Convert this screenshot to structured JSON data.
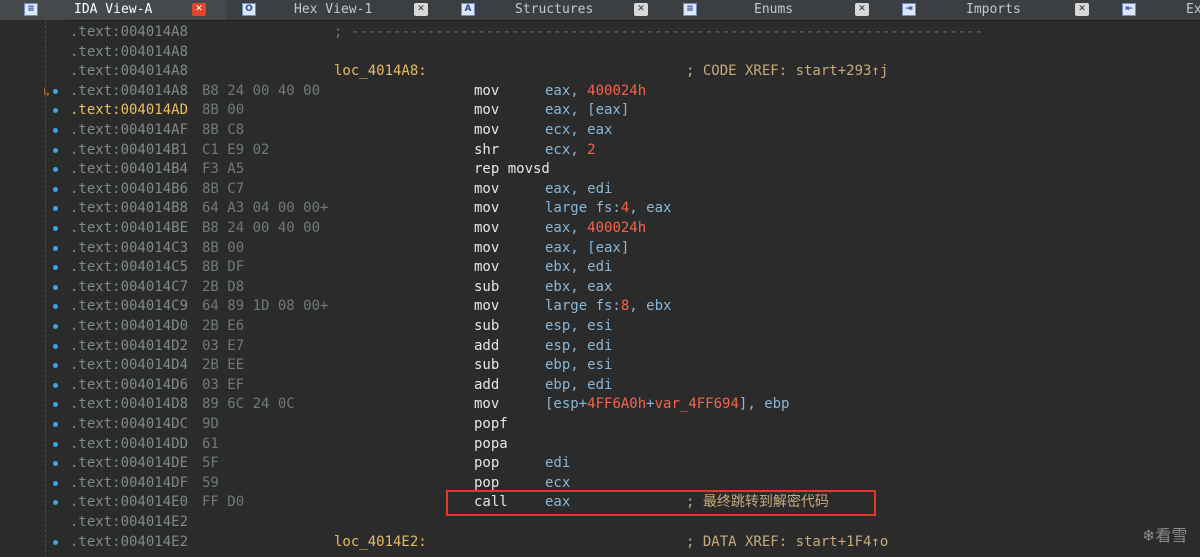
{
  "tabs": [
    {
      "icon": "ida-view-icon",
      "icon_glyph": "≡",
      "label": "IDA View-A",
      "active": true
    },
    {
      "icon": "hex-view-icon",
      "icon_glyph": "O",
      "label": "Hex View-1",
      "active": false
    },
    {
      "icon": "structures-icon",
      "icon_glyph": "A",
      "label": "Structures",
      "active": false
    },
    {
      "icon": "enums-icon",
      "icon_glyph": "≡",
      "label": "Enums",
      "active": false
    },
    {
      "icon": "imports-icon",
      "icon_glyph": "⇥",
      "label": "Imports",
      "active": false
    },
    {
      "icon": "exports-icon",
      "icon_glyph": "⇤",
      "label": "Ex",
      "active": false
    }
  ],
  "separator_text": "; ---------------------------------------------------------------------------",
  "rows": [
    {
      "addr": ".text:004014A8",
      "bytes": "",
      "label": "",
      "mnem": "",
      "ops": [],
      "cmt": "",
      "sep": true,
      "dot": false
    },
    {
      "addr": ".text:004014A8",
      "bytes": "",
      "label": "",
      "mnem": "",
      "ops": [],
      "cmt": "",
      "sep": false,
      "dot": false
    },
    {
      "addr": ".text:004014A8",
      "bytes": "",
      "label": "loc_4014A8:",
      "mnem": "",
      "ops": [],
      "cmt": "; CODE XREF: start+293↑j",
      "sep": false,
      "dot": false
    },
    {
      "addr": ".text:004014A8",
      "bytes": "B8 24 00 40 00",
      "label": "",
      "mnem": "mov",
      "ops": [
        {
          "t": "eax, "
        },
        {
          "t": "400024h",
          "num": true
        }
      ],
      "cmt": "",
      "sep": false,
      "dot": true,
      "arrow": true
    },
    {
      "addr": ".text:004014AD",
      "bytes": "8B 00",
      "label": "",
      "mnem": "mov",
      "ops": [
        {
          "t": "eax, [eax]"
        }
      ],
      "cmt": "",
      "sep": false,
      "dot": true,
      "hl": true
    },
    {
      "addr": ".text:004014AF",
      "bytes": "8B C8",
      "label": "",
      "mnem": "mov",
      "ops": [
        {
          "t": "ecx, eax"
        }
      ],
      "cmt": "",
      "sep": false,
      "dot": true
    },
    {
      "addr": ".text:004014B1",
      "bytes": "C1 E9 02",
      "label": "",
      "mnem": "shr",
      "ops": [
        {
          "t": "ecx, "
        },
        {
          "t": "2",
          "num": true
        }
      ],
      "cmt": "",
      "sep": false,
      "dot": true
    },
    {
      "addr": ".text:004014B4",
      "bytes": "F3 A5",
      "label": "",
      "mnem": "rep movsd",
      "ops": [],
      "cmt": "",
      "sep": false,
      "dot": true
    },
    {
      "addr": ".text:004014B6",
      "bytes": "8B C7",
      "label": "",
      "mnem": "mov",
      "ops": [
        {
          "t": "eax, edi"
        }
      ],
      "cmt": "",
      "sep": false,
      "dot": true
    },
    {
      "addr": ".text:004014B8",
      "bytes": "64 A3 04 00 00+",
      "label": "",
      "mnem": "mov",
      "ops": [
        {
          "t": "large fs:"
        },
        {
          "t": "4",
          "num": true
        },
        {
          "t": ", eax"
        }
      ],
      "cmt": "",
      "sep": false,
      "dot": true
    },
    {
      "addr": ".text:004014BE",
      "bytes": "B8 24 00 40 00",
      "label": "",
      "mnem": "mov",
      "ops": [
        {
          "t": "eax, "
        },
        {
          "t": "400024h",
          "num": true
        }
      ],
      "cmt": "",
      "sep": false,
      "dot": true
    },
    {
      "addr": ".text:004014C3",
      "bytes": "8B 00",
      "label": "",
      "mnem": "mov",
      "ops": [
        {
          "t": "eax, [eax]"
        }
      ],
      "cmt": "",
      "sep": false,
      "dot": true
    },
    {
      "addr": ".text:004014C5",
      "bytes": "8B DF",
      "label": "",
      "mnem": "mov",
      "ops": [
        {
          "t": "ebx, edi"
        }
      ],
      "cmt": "",
      "sep": false,
      "dot": true
    },
    {
      "addr": ".text:004014C7",
      "bytes": "2B D8",
      "label": "",
      "mnem": "sub",
      "ops": [
        {
          "t": "ebx, eax"
        }
      ],
      "cmt": "",
      "sep": false,
      "dot": true
    },
    {
      "addr": ".text:004014C9",
      "bytes": "64 89 1D 08 00+",
      "label": "",
      "mnem": "mov",
      "ops": [
        {
          "t": "large fs:"
        },
        {
          "t": "8",
          "num": true
        },
        {
          "t": ", ebx"
        }
      ],
      "cmt": "",
      "sep": false,
      "dot": true
    },
    {
      "addr": ".text:004014D0",
      "bytes": "2B E6",
      "label": "",
      "mnem": "sub",
      "ops": [
        {
          "t": "esp, esi"
        }
      ],
      "cmt": "",
      "sep": false,
      "dot": true
    },
    {
      "addr": ".text:004014D2",
      "bytes": "03 E7",
      "label": "",
      "mnem": "add",
      "ops": [
        {
          "t": "esp, edi"
        }
      ],
      "cmt": "",
      "sep": false,
      "dot": true
    },
    {
      "addr": ".text:004014D4",
      "bytes": "2B EE",
      "label": "",
      "mnem": "sub",
      "ops": [
        {
          "t": "ebp, esi"
        }
      ],
      "cmt": "",
      "sep": false,
      "dot": true
    },
    {
      "addr": ".text:004014D6",
      "bytes": "03 EF",
      "label": "",
      "mnem": "add",
      "ops": [
        {
          "t": "ebp, edi"
        }
      ],
      "cmt": "",
      "sep": false,
      "dot": true
    },
    {
      "addr": ".text:004014D8",
      "bytes": "89 6C 24 0C",
      "label": "",
      "mnem": "mov",
      "ops": [
        {
          "t": "[esp+"
        },
        {
          "t": "4FF6A0h",
          "num": true
        },
        {
          "t": "+"
        },
        {
          "t": "var_4FF694",
          "num": true
        },
        {
          "t": "], ebp"
        }
      ],
      "cmt": "",
      "sep": false,
      "dot": true
    },
    {
      "addr": ".text:004014DC",
      "bytes": "9D",
      "label": "",
      "mnem": "popf",
      "ops": [],
      "cmt": "",
      "sep": false,
      "dot": true
    },
    {
      "addr": ".text:004014DD",
      "bytes": "61",
      "label": "",
      "mnem": "popa",
      "ops": [],
      "cmt": "",
      "sep": false,
      "dot": true
    },
    {
      "addr": ".text:004014DE",
      "bytes": "5F",
      "label": "",
      "mnem": "pop",
      "ops": [
        {
          "t": "edi"
        }
      ],
      "cmt": "",
      "sep": false,
      "dot": true
    },
    {
      "addr": ".text:004014DF",
      "bytes": "59",
      "label": "",
      "mnem": "pop",
      "ops": [
        {
          "t": "ecx"
        }
      ],
      "cmt": "",
      "sep": false,
      "dot": true
    },
    {
      "addr": ".text:004014E0",
      "bytes": "FF D0",
      "label": "",
      "mnem": "call",
      "ops": [
        {
          "t": "eax"
        }
      ],
      "cmt": "; 最终跳转到解密代码",
      "sep": false,
      "dot": true
    },
    {
      "addr": ".text:004014E2",
      "bytes": "",
      "label": "",
      "mnem": "",
      "ops": [],
      "cmt": "",
      "sep": false,
      "dot": false
    },
    {
      "addr": ".text:004014E2",
      "bytes": "",
      "label": "loc_4014E2:",
      "mnem": "",
      "ops": [],
      "cmt": "; DATA XREF: start+1F4↑o",
      "sep": false,
      "dot": true
    }
  ],
  "watermark": "❄看雪"
}
